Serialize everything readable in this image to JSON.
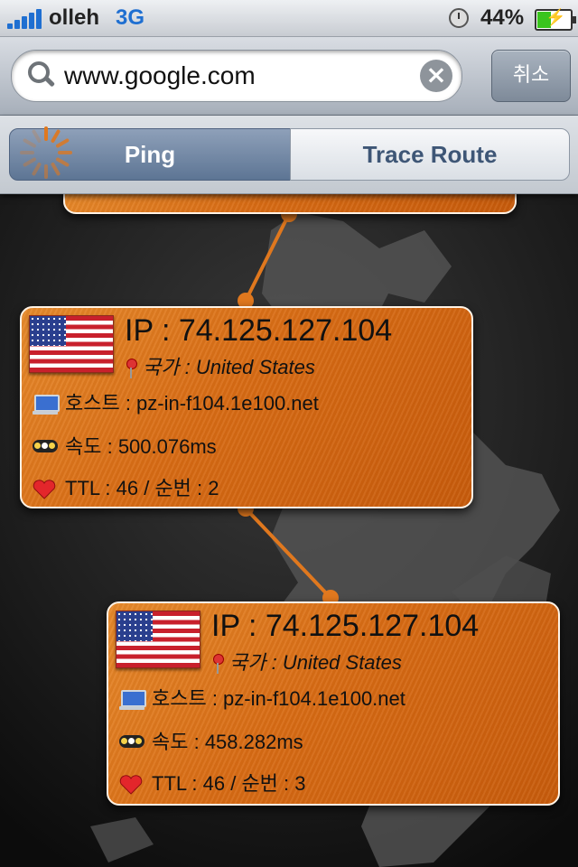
{
  "status_bar": {
    "carrier": "olleh",
    "network": "3G",
    "battery_percent": "44%",
    "battery_level": 0.44,
    "signal_bars": 5
  },
  "search": {
    "value": "www.google.com",
    "cancel_label": "취소"
  },
  "tabs": {
    "ping_label": "Ping",
    "trace_label": "Trace Route",
    "selected": "Ping"
  },
  "results": [
    {
      "ip": "IP : 74.125.127.104",
      "country": "국가 : United States",
      "host": "호스트 : pz-in-f104.1e100.net",
      "speed": "속도 : 500.076ms",
      "ttl": "TTL : 46 / 순번 : 2"
    },
    {
      "ip": "IP : 74.125.127.104",
      "country": "국가 : United States",
      "host": "호스트 : pz-in-f104.1e100.net",
      "speed": "속도 : 458.282ms",
      "ttl": "TTL : 46 / 순번 : 3"
    }
  ],
  "colors": {
    "accent_blue": "#1f6fd1",
    "card_orange": "#d86b14",
    "route_line": "#e0781e"
  },
  "icons": [
    "signal-bars-icon",
    "clock-icon",
    "battery-icon",
    "search-icon",
    "clear-icon",
    "spinner-icon",
    "us-flag-icon",
    "map-pin-icon",
    "computer-icon",
    "traffic-light-icon",
    "heart-icon"
  ]
}
